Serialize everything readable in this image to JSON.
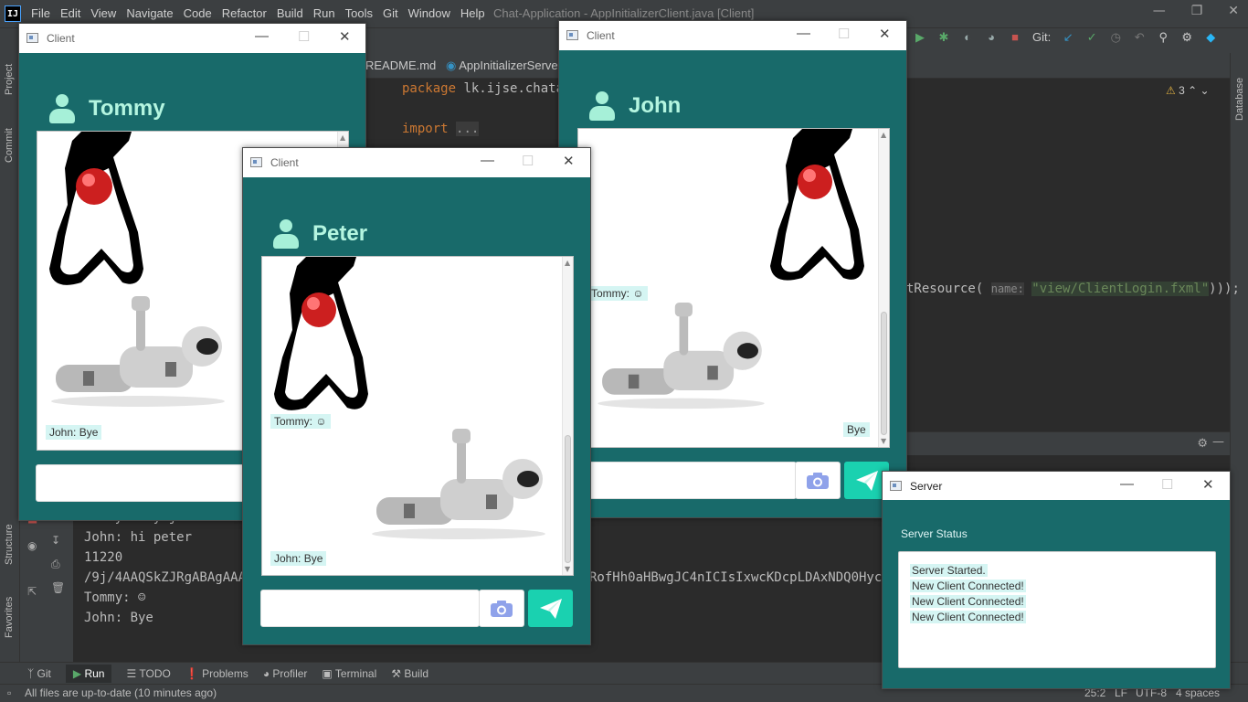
{
  "ide": {
    "logo_text": "IJ",
    "menu": [
      "File",
      "Edit",
      "View",
      "Navigate",
      "Code",
      "Refactor",
      "Build",
      "Run",
      "Tools",
      "Git",
      "Window",
      "Help"
    ],
    "title": "Chat-Application - AppInitializerClient.java [Client]",
    "tabs": [
      "README.md",
      "AppInitializerServer."
    ],
    "git_label": "Git:",
    "warnings_count": "3",
    "code": {
      "package_kw": "package",
      "package_name": "lk.ijse.chatap",
      "import_kw": "import",
      "import_ellipsis": "...",
      "resource_call": "tResource(",
      "param_hint": "name:",
      "resource_string": "\"view/ClientLogin.fxml\"",
      "resource_tail": ")));"
    },
    "side_left": [
      "Project",
      "Commit",
      "Structure",
      "Favorites"
    ],
    "side_right": [
      "Database"
    ],
    "run_output": [
      "Tommy: hey john",
      "John: hi peter",
      "11220",
      "/9j/4AAQSkZJRgABAgAAAQ",
      "Tommy: ☺",
      "John: Bye"
    ],
    "run_output_tail": "RofHh0aHBwgJC4nICIsIxwcKDcpLDAxNDQ0Hyc5P",
    "bottom_tabs": [
      "Git",
      "Run",
      "TODO",
      "Problems",
      "Profiler",
      "Terminal",
      "Build"
    ],
    "status_left": "All files are up-to-date (10 minutes ago)",
    "status_right": {
      "position": "25:2",
      "line_sep": "LF",
      "encoding": "UTF-8",
      "indent": "4 spaces"
    }
  },
  "windows": {
    "tommy": {
      "title": "Client",
      "user_name": "Tommy",
      "messages": {
        "john_bye": "John: Bye"
      }
    },
    "peter": {
      "title": "Client",
      "user_name": "Peter",
      "messages": {
        "tommy_smile": "Tommy: ☺",
        "john_bye": "John: Bye"
      }
    },
    "john": {
      "title": "Client",
      "user_name": "John",
      "messages": {
        "tommy_smile": "Tommy: ☺",
        "bye": "Bye"
      }
    },
    "server": {
      "title": "Server",
      "status_label": "Server Status",
      "log": [
        "Server Started.",
        "New Client Connected!",
        "New Client Connected!",
        "New Client Connected!"
      ]
    }
  },
  "colors": {
    "window_bg": "#186a6a",
    "accent": "#1ad1b0",
    "bubble": "#d5f5f3",
    "user_icon": "#a6f0d8"
  }
}
